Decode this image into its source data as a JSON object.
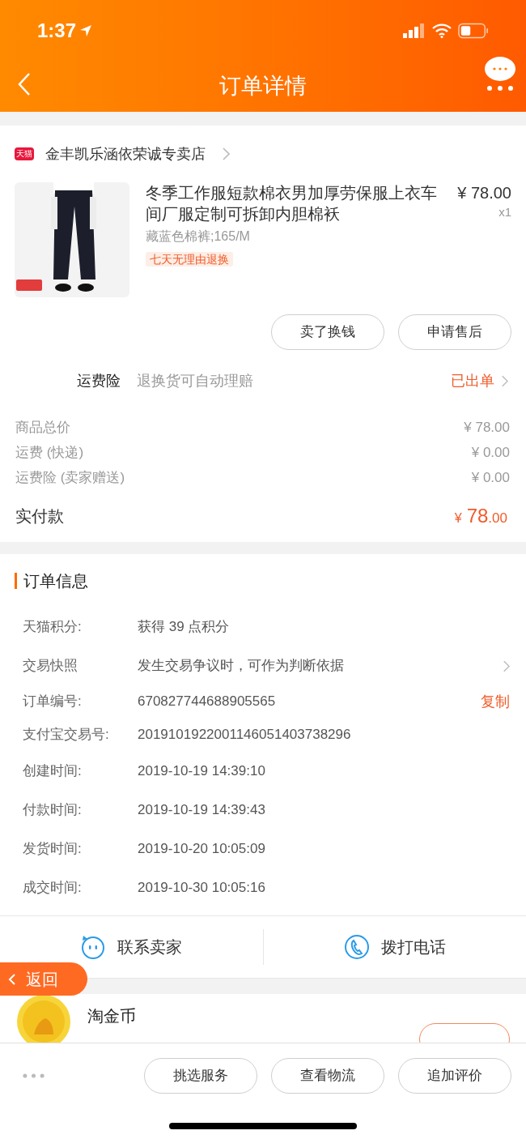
{
  "status_bar": {
    "time": "1:37"
  },
  "nav": {
    "title": "订单详情"
  },
  "shop": {
    "badge": "天猫",
    "name": "金丰凯乐涵依荣诚专卖店"
  },
  "product": {
    "title": "冬季工作服短款棉衣男加厚劳保服上衣车间厂服定制可拆卸内胆棉袄",
    "price": "¥ 78.00",
    "quantity": "x1",
    "sku": "藏蓝色棉裤;165/M",
    "tag": "七天无理由退换"
  },
  "item_buttons": [
    "卖了换钱",
    "申请售后"
  ],
  "insurance": {
    "label": "运费险",
    "description": "退换货可自动理赔",
    "status": "已出单"
  },
  "price_rows": [
    {
      "label": "商品总价",
      "value": "¥ 78.00"
    },
    {
      "label": "运费 (快递)",
      "value": "¥ 0.00"
    },
    {
      "label": "运费险 (卖家赠送)",
      "value": "¥ 0.00"
    }
  ],
  "paid": {
    "label": "实付款",
    "currency": "¥",
    "amount": "78",
    "cents": ".00"
  },
  "order_info": {
    "title": "订单信息",
    "rows": [
      {
        "kind": "plain",
        "label": "天猫积分:",
        "value": "获得 39 点积分"
      },
      {
        "kind": "link",
        "label": "交易快照",
        "value": "发生交易争议时，可作为判断依据"
      },
      {
        "kind": "copy",
        "label": "订单编号:",
        "value": "670827744688905565",
        "action": "复制"
      },
      {
        "kind": "plain",
        "label": "支付宝交易号:",
        "value": "2019101922001146051403738296"
      },
      {
        "kind": "plain",
        "label": "创建时间:",
        "value": "2019-10-19 14:39:10"
      },
      {
        "kind": "plain",
        "label": "付款时间:",
        "value": "2019-10-19 14:39:43"
      },
      {
        "kind": "plain",
        "label": "发货时间:",
        "value": "2019-10-20 10:05:09"
      },
      {
        "kind": "plain",
        "label": "成交时间:",
        "value": "2019-10-30 10:05:16"
      }
    ]
  },
  "contact": [
    {
      "kind": "chat",
      "label": "联系卖家"
    },
    {
      "kind": "phone",
      "label": "拨打电话"
    }
  ],
  "float_back": {
    "label": "返回"
  },
  "coin": {
    "title": "淘金币"
  },
  "bottom_bar": {
    "buttons": [
      "挑选服务",
      "查看物流",
      "追加评价"
    ]
  }
}
